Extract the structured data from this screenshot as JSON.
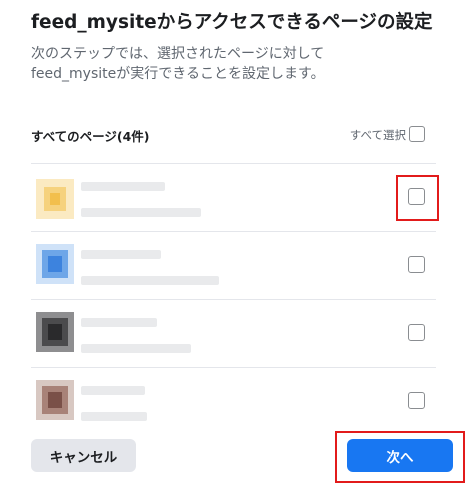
{
  "dialog": {
    "title": "feed_mysiteからアクセスできるページの設定",
    "description_line1": "次のステップでは、選択されたページに対して",
    "description_line2": "feed_mysiteが実行できることを設定します。"
  },
  "list": {
    "all_pages_label": "すべてのページ(4件)",
    "select_all_label": "すべて選択",
    "select_all_checked": false,
    "pages": [
      {
        "thumbnail_color": "#f6c96a",
        "checked": false
      },
      {
        "thumbnail_color": "#4a8fe0",
        "checked": false
      },
      {
        "thumbnail_color": "#3a3a3c",
        "checked": false
      },
      {
        "thumbnail_color": "#b99a8e",
        "checked": false
      }
    ]
  },
  "footer": {
    "cancel_label": "キャンセル",
    "next_label": "次へ"
  },
  "colors": {
    "primary": "#1877f2",
    "annotation_red": "#e21b1b"
  }
}
